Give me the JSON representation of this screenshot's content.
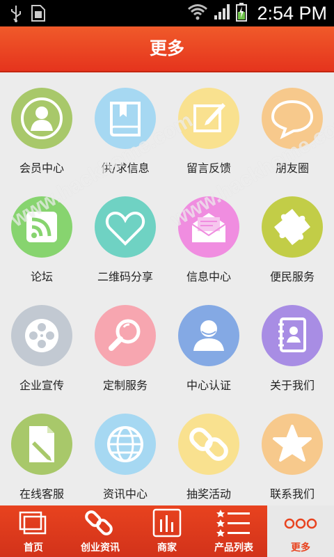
{
  "status_bar": {
    "time": "2:54 PM",
    "icons": [
      "usb-icon",
      "sim-icon",
      "wifi-icon",
      "signal-icon",
      "battery-charging-icon"
    ]
  },
  "header": {
    "title": "更多"
  },
  "grid": {
    "items": [
      {
        "label": "会员中心",
        "icon": "member-icon",
        "color": "#a8c86a"
      },
      {
        "label": "供/求信息",
        "icon": "book-icon",
        "color": "#a6d8f2"
      },
      {
        "label": "留言反馈",
        "icon": "edit-icon",
        "color": "#f9e18f"
      },
      {
        "label": "朋友圈",
        "icon": "chat-bubble-icon",
        "color": "#f7c98c"
      },
      {
        "label": "论坛",
        "icon": "rss-icon",
        "color": "#87d46f"
      },
      {
        "label": "二维码分享",
        "icon": "heart-icon",
        "color": "#6fd2c3"
      },
      {
        "label": "信息中心",
        "icon": "mail-icon",
        "color": "#f08de0"
      },
      {
        "label": "便民服务",
        "icon": "puzzle-icon",
        "color": "#c2cd47"
      },
      {
        "label": "企业宣传",
        "icon": "film-reel-icon",
        "color": "#c2c9d2"
      },
      {
        "label": "定制服务",
        "icon": "magnifier-icon",
        "color": "#f7a6b0"
      },
      {
        "label": "中心认证",
        "icon": "user-icon",
        "color": "#84a9e4"
      },
      {
        "label": "关于我们",
        "icon": "contacts-icon",
        "color": "#a88de4"
      },
      {
        "label": "在线客服",
        "icon": "document-edit-icon",
        "color": "#a8c86a"
      },
      {
        "label": "资讯中心",
        "icon": "globe-icon",
        "color": "#a6d8f2"
      },
      {
        "label": "抽奖活动",
        "icon": "link-icon",
        "color": "#f9e18f"
      },
      {
        "label": "联系我们",
        "icon": "star-icon",
        "color": "#f7c98c"
      }
    ]
  },
  "bottom_nav": {
    "items": [
      {
        "label": "首页",
        "icon": "home-window-icon"
      },
      {
        "label": "创业资讯",
        "icon": "chain-icon"
      },
      {
        "label": "商家",
        "icon": "bar-chart-icon"
      },
      {
        "label": "产品列表",
        "icon": "list-icon"
      },
      {
        "label": "更多",
        "icon": "more-dots-icon",
        "active": true
      }
    ]
  },
  "watermark": "www.hackhome.com"
}
